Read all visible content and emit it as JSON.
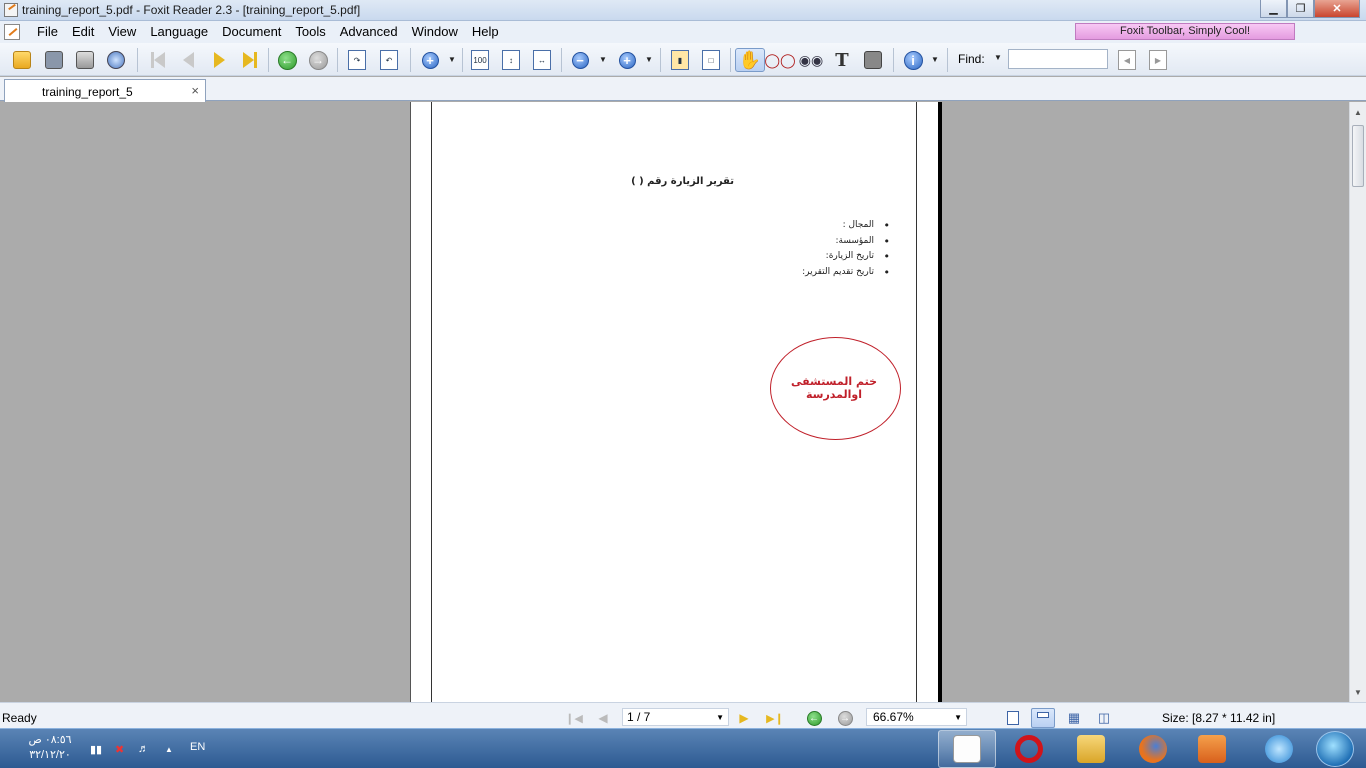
{
  "window": {
    "title": "training_report_5.pdf - Foxit Reader 2.3 - [training_report_5.pdf]",
    "minimize_glyph": "▁",
    "maximize_glyph": "❐",
    "close_glyph": "✕"
  },
  "menu": {
    "items": [
      "File",
      "Edit",
      "View",
      "Language",
      "Document",
      "Tools",
      "Advanced",
      "Window",
      "Help"
    ],
    "promo": "Foxit Toolbar, Simply Cool!"
  },
  "toolbar": {
    "find_label": "Find:",
    "find_value": "",
    "icons": [
      "open-folder-icon",
      "save-icon",
      "print-icon",
      "web-icon",
      "first-page-icon",
      "previous-page-icon",
      "next-page-icon",
      "last-page-icon",
      "go-back-icon",
      "go-forward-icon",
      "extract-pages-icon",
      "rotate-pages-icon",
      "zoom-in-tool-icon",
      "actual-size-icon",
      "fit-page-icon",
      "fit-width-icon",
      "zoom-out-icon",
      "zoom-in-icon",
      "bookmark-icon",
      "full-screen-icon",
      "hand-tool-icon",
      "reader-glasses-icon",
      "find-binoculars-icon",
      "text-select-icon",
      "snapshot-camera-icon",
      "info-icon",
      "find-previous-icon",
      "find-next-icon"
    ]
  },
  "tab": {
    "label": "training_report_5",
    "close_glyph": "×"
  },
  "document": {
    "title": "تقرير الزيارة رقم (          )",
    "items": [
      "المجال :",
      "المؤسسة:",
      "تاريخ الزيارة:",
      "تاريخ تقديم التقرير:"
    ],
    "stamp_text": "ختم المستشفى اوالمدرسة",
    "stamp_color": "#c0202a"
  },
  "status": {
    "text": "Ready",
    "page_field": "1 / 7",
    "zoom": "66.67%",
    "size": "Size: [8.27 * 11.42 in]"
  },
  "taskbar": {
    "time": "٠٨:٥٦ ص",
    "date": "٣٢/١٢/٢٠",
    "language": "EN",
    "apps": [
      "foxit-reader-icon",
      "opera-icon",
      "file-explorer-icon",
      "firefox-icon",
      "media-player-icon",
      "internet-explorer-icon"
    ]
  },
  "colors": {
    "accent": "#2d5a92",
    "promo_bg": "#e49be0"
  }
}
